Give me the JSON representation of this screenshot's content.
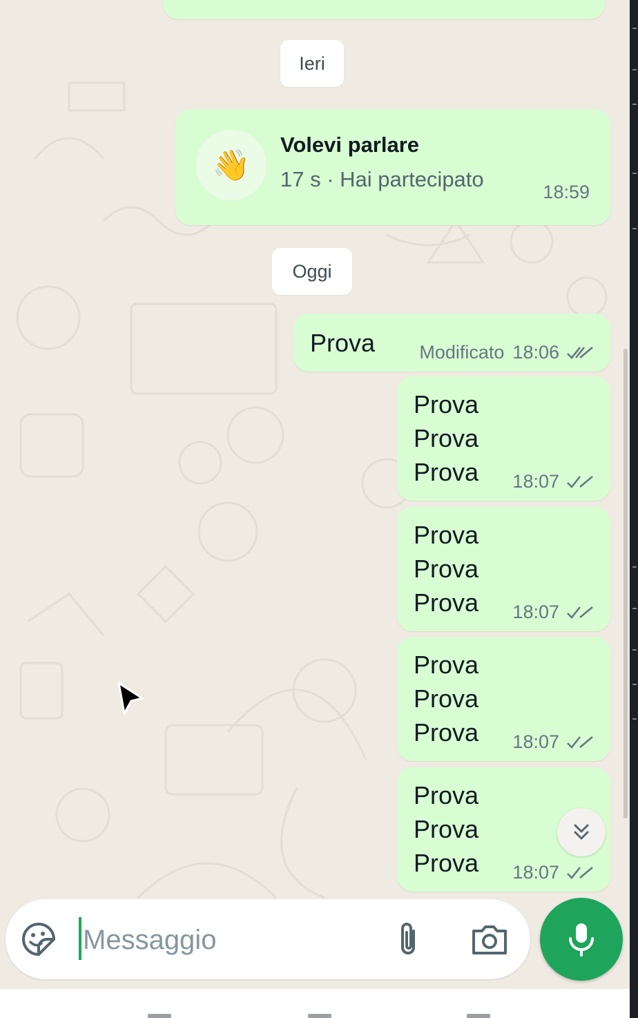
{
  "chat": {
    "date_yesterday": "Ieri",
    "date_today": "Oggi",
    "call": {
      "emoji": "👋",
      "title": "Volevi parlare",
      "subtitle": "17 s · Hai partecipato",
      "time": "18:59"
    },
    "edited_message": {
      "text": "Prova",
      "edited_label": "Modificato",
      "time": "18:06",
      "status": "read"
    },
    "messages": [
      {
        "lines": [
          "Prova",
          "Prova",
          "Prova"
        ],
        "time": "18:07",
        "status": "read"
      },
      {
        "lines": [
          "Prova",
          "Prova",
          "Prova"
        ],
        "time": "18:07",
        "status": "read"
      },
      {
        "lines": [
          "Prova",
          "Prova",
          "Prova"
        ],
        "time": "18:07",
        "status": "read"
      },
      {
        "lines": [
          "Prova",
          "Prova",
          "Prova"
        ],
        "time": "18:07",
        "status": "read"
      }
    ]
  },
  "composer": {
    "placeholder": "Messaggio",
    "icons": {
      "emoji": "sticker-emoji-icon",
      "attach": "paperclip-icon",
      "camera": "camera-icon",
      "mic": "microphone-icon",
      "scroll": "double-chevron-down-icon"
    }
  },
  "colors": {
    "background": "#efeae2",
    "outgoing_bubble": "#d9fdd3",
    "accent": "#1ea55b",
    "read_ticks": "#667781"
  }
}
